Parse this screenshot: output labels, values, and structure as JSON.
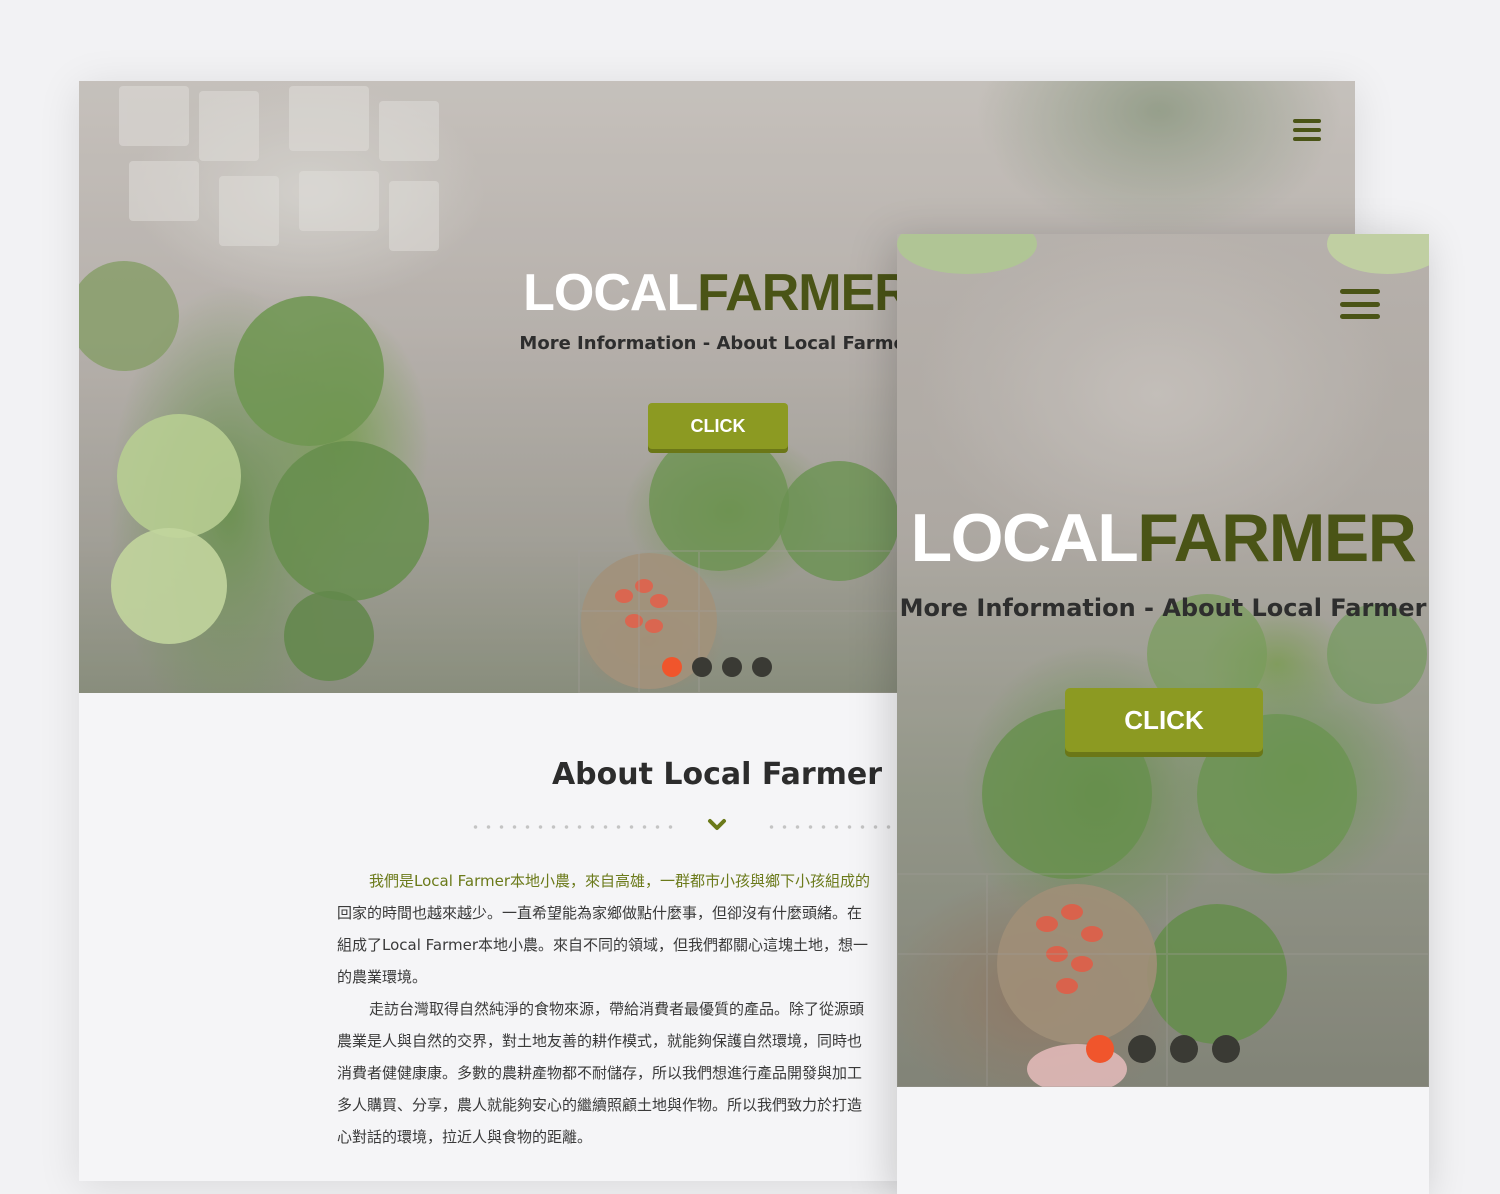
{
  "desktop": {
    "hero": {
      "logo_part1": "LOCAL",
      "logo_part2": "FARMER",
      "tagline": "More Information - About Local Farmer",
      "cta_label": "CLICK",
      "slides": [
        {
          "active": true
        },
        {
          "active": false
        },
        {
          "active": false
        },
        {
          "active": false
        }
      ]
    },
    "about": {
      "title": "About Local Farmer",
      "paragraph1_line1": "我們是Local Farmer本地小農，來自高雄，一群都市小孩與鄉下小孩組成的",
      "paragraph1_line2": "回家的時間也越來越少。一直希望能為家鄉做點什麼事，但卻沒有什麼頭緒。在",
      "paragraph1_line3": "組成了Local Farmer本地小農。來自不同的領域，但我們都關心這塊土地，想一",
      "paragraph1_line4": "的農業環境。",
      "paragraph2_line1": "走訪台灣取得自然純淨的食物來源，帶給消費者最優質的產品。除了從源頭",
      "paragraph2_line2": "農業是人與自然的交界，對土地友善的耕作模式，就能夠保護自然環境，同時也",
      "paragraph2_line3": "消費者健健康康。多數的農耕產物都不耐儲存，所以我們想進行產品開發與加工",
      "paragraph2_line4": "多人購買、分享，農人就能夠安心的繼續照顧土地與作物。所以我們致力於打造",
      "paragraph2_line5": "心對話的環境，拉近人與食物的距離。"
    }
  },
  "mobile": {
    "hero": {
      "logo_part1": "LOCAL",
      "logo_part2": "FARMER",
      "tagline": "More Information - About Local Farmer",
      "cta_label": "CLICK",
      "slides": [
        {
          "active": true
        },
        {
          "active": false
        },
        {
          "active": false
        },
        {
          "active": false
        }
      ]
    }
  },
  "colors": {
    "brand_olive": "#4a5416",
    "button_green": "#8c9a22",
    "accent_orange": "#f0552c",
    "highlight_text": "#6b7a1a"
  },
  "icons": {
    "menu": "hamburger-menu-icon",
    "divider": "chevron-down-icon"
  }
}
